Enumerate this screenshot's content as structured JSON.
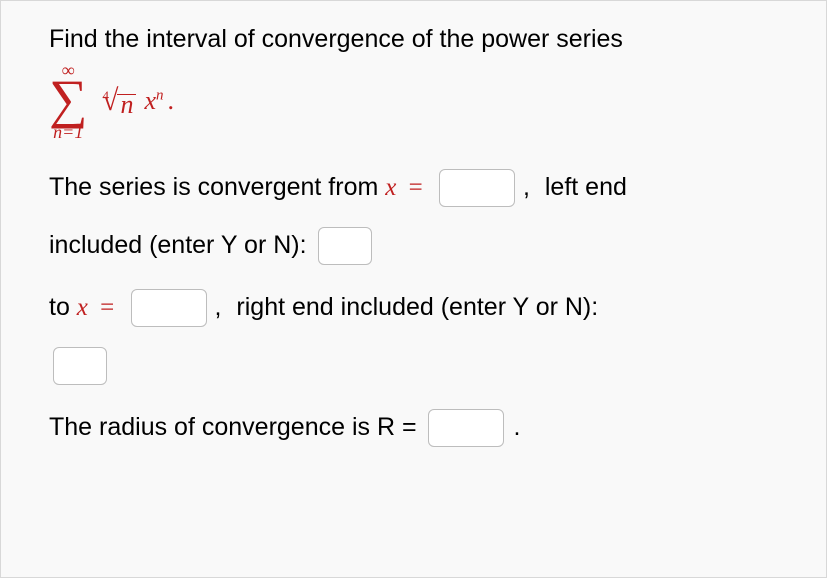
{
  "problem": {
    "prompt": "Find the interval of convergence of the power series",
    "series": {
      "upper": "∞",
      "lower": "n=1",
      "root_index": "4",
      "radicand": "n",
      "var": "x",
      "exp": "n",
      "period": "."
    }
  },
  "q1": {
    "lead": "The series is convergent from ",
    "xvar": "x",
    "eq": " = ",
    "comma": ",",
    "tail": " left end"
  },
  "q2": {
    "lead": "included (enter Y or N): "
  },
  "q3": {
    "lead": "to ",
    "xvar": "x",
    "eq": " = ",
    "comma": ",",
    "tail": " right end included (enter Y or N):"
  },
  "q4": {
    "lead": "The radius of convergence is R = ",
    "dot": "."
  },
  "inputs": {
    "from_x": "",
    "left_end_yn": "",
    "to_x": "",
    "right_end_yn": "",
    "radius": ""
  }
}
